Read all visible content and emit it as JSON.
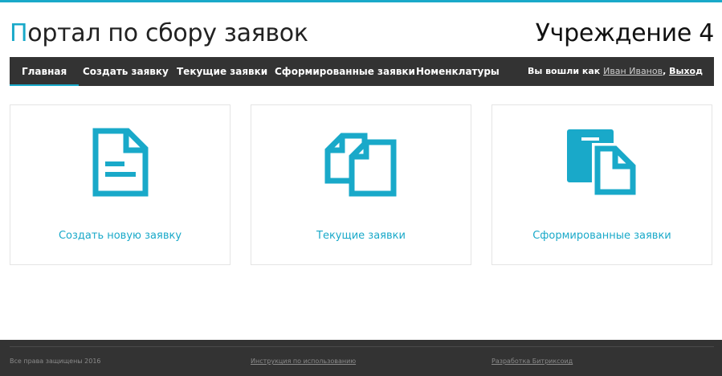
{
  "header": {
    "title_first_letter": "П",
    "title_rest": "ортал по сбору заявок",
    "organization": "Учреждение 4"
  },
  "nav": {
    "items": [
      {
        "label": "Главная",
        "active": true
      },
      {
        "label": "Создать заявку",
        "active": false
      },
      {
        "label": "Текущие заявки",
        "active": false
      },
      {
        "label": "Сформированные заявки",
        "active": false
      },
      {
        "label": "Номенклатуры",
        "active": false
      }
    ],
    "user_prefix": "Вы вошли как",
    "user_name": "Иван Иванов",
    "separator": ",",
    "logout_label": "Выход"
  },
  "cards": [
    {
      "label": "Создать новую заявку",
      "icon": "document-icon"
    },
    {
      "label": "Текущие заявки",
      "icon": "documents-copy-icon"
    },
    {
      "label": "Сформированные заявки",
      "icon": "clipboard-document-icon"
    }
  ],
  "footer": {
    "copyright": "Все права защищены 2016",
    "instructions_link": "Инструкция по использованию",
    "developer_link": "Разработка Битриксоид"
  },
  "colors": {
    "accent": "#19a9c9",
    "nav_bg": "#333333",
    "footer_bg": "#333333"
  }
}
